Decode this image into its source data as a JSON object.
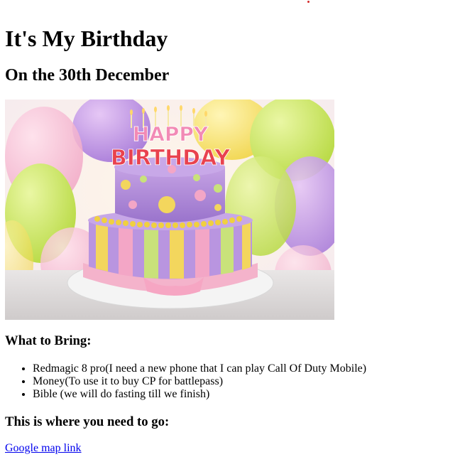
{
  "title": "It's My Birthday",
  "subtitle": "On the 30th December",
  "image": {
    "alt": "birthday-cake-photo",
    "topper_line1": "HAPPY",
    "topper_line2": "BIRTHDAY"
  },
  "bring": {
    "heading": "What to Bring:",
    "items": [
      "Redmagic 8 pro(I need a new phone that I can play Call Of Duty Mobile)",
      "Money(To use it to buy CP for battlepass)",
      "Bible (we will do fasting till we finish)"
    ]
  },
  "location": {
    "heading": "This is where you need to go:",
    "link_label": "Google map link"
  },
  "colors": {
    "link": "#0000ee",
    "cake_purple": "#b08ad6",
    "cake_yellow": "#f2d64a",
    "cake_pink": "#f4a9c4"
  }
}
